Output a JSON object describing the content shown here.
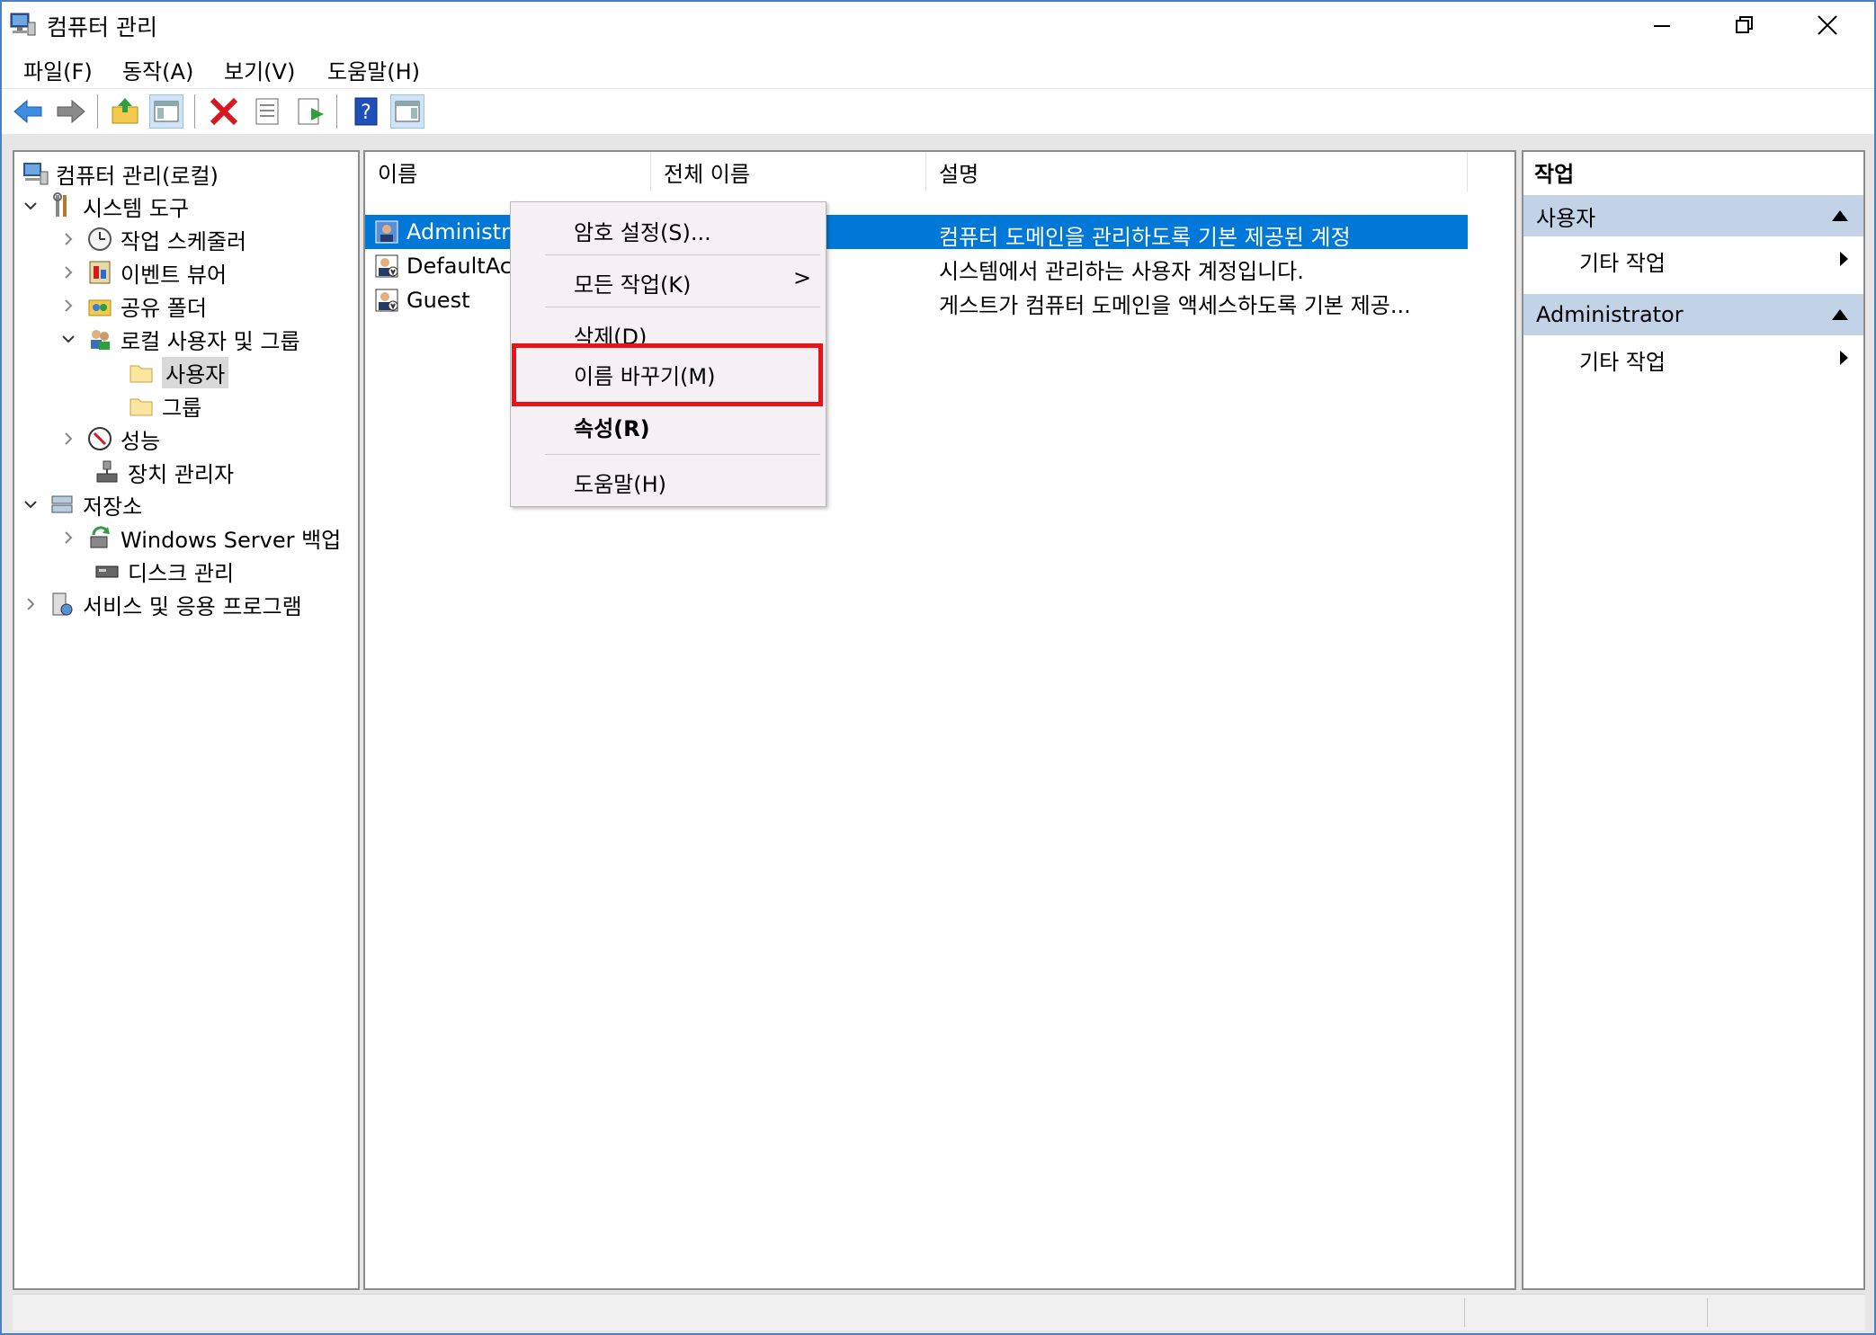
{
  "window": {
    "title": "컴퓨터 관리"
  },
  "menubar": {
    "items": [
      "파일(F)",
      "동작(A)",
      "보기(V)",
      "도움말(H)"
    ]
  },
  "toolbar": {
    "buttons": [
      "back-icon",
      "forward-icon",
      "up-folder-icon",
      "show-tree-icon",
      "delete-icon",
      "properties-icon",
      "export-icon",
      "help-icon",
      "action-pane-icon"
    ]
  },
  "tree": {
    "root": "컴퓨터 관리(로컬)",
    "system_tools": "시스템 도구",
    "task_scheduler": "작업 스케줄러",
    "event_viewer": "이벤트 뷰어",
    "shared_folders": "공유 폴더",
    "local_users_groups": "로컬 사용자 및 그룹",
    "users": "사용자",
    "groups": "그룹",
    "performance": "성능",
    "device_manager": "장치 관리자",
    "storage": "저장소",
    "windows_backup": "Windows Server 백업",
    "disk_management": "디스크 관리",
    "services_apps": "서비스 및 응용 프로그램"
  },
  "list": {
    "columns": [
      "이름",
      "전체 이름",
      "설명"
    ],
    "rows": [
      {
        "name": "Administra",
        "full_name": "",
        "description": "컴퓨터 도메인을 관리하도록 기본 제공된 계정"
      },
      {
        "name": "DefaultAcc",
        "full_name": "",
        "description": "시스템에서 관리하는 사용자 계정입니다."
      },
      {
        "name": "Guest",
        "full_name": "",
        "description": "게스트가 컴퓨터 도메인을 액세스하도록 기본 제공..."
      }
    ]
  },
  "context_menu": {
    "set_password": "암호 설정(S)...",
    "all_tasks": "모든 작업(K)",
    "all_tasks_arrow": ">",
    "delete": "삭제(D)",
    "rename": "이름 바꾸기(M)",
    "properties": "속성(R)",
    "help": "도움말(H)"
  },
  "actions": {
    "header": "작업",
    "group1": "사용자",
    "group1_more": "기타 작업",
    "group2": "Administrator",
    "group2_more": "기타 작업"
  },
  "colors": {
    "selection": "#0078d7",
    "highlight_box": "#e8141a",
    "action_group_bg": "#c3d3e7"
  }
}
